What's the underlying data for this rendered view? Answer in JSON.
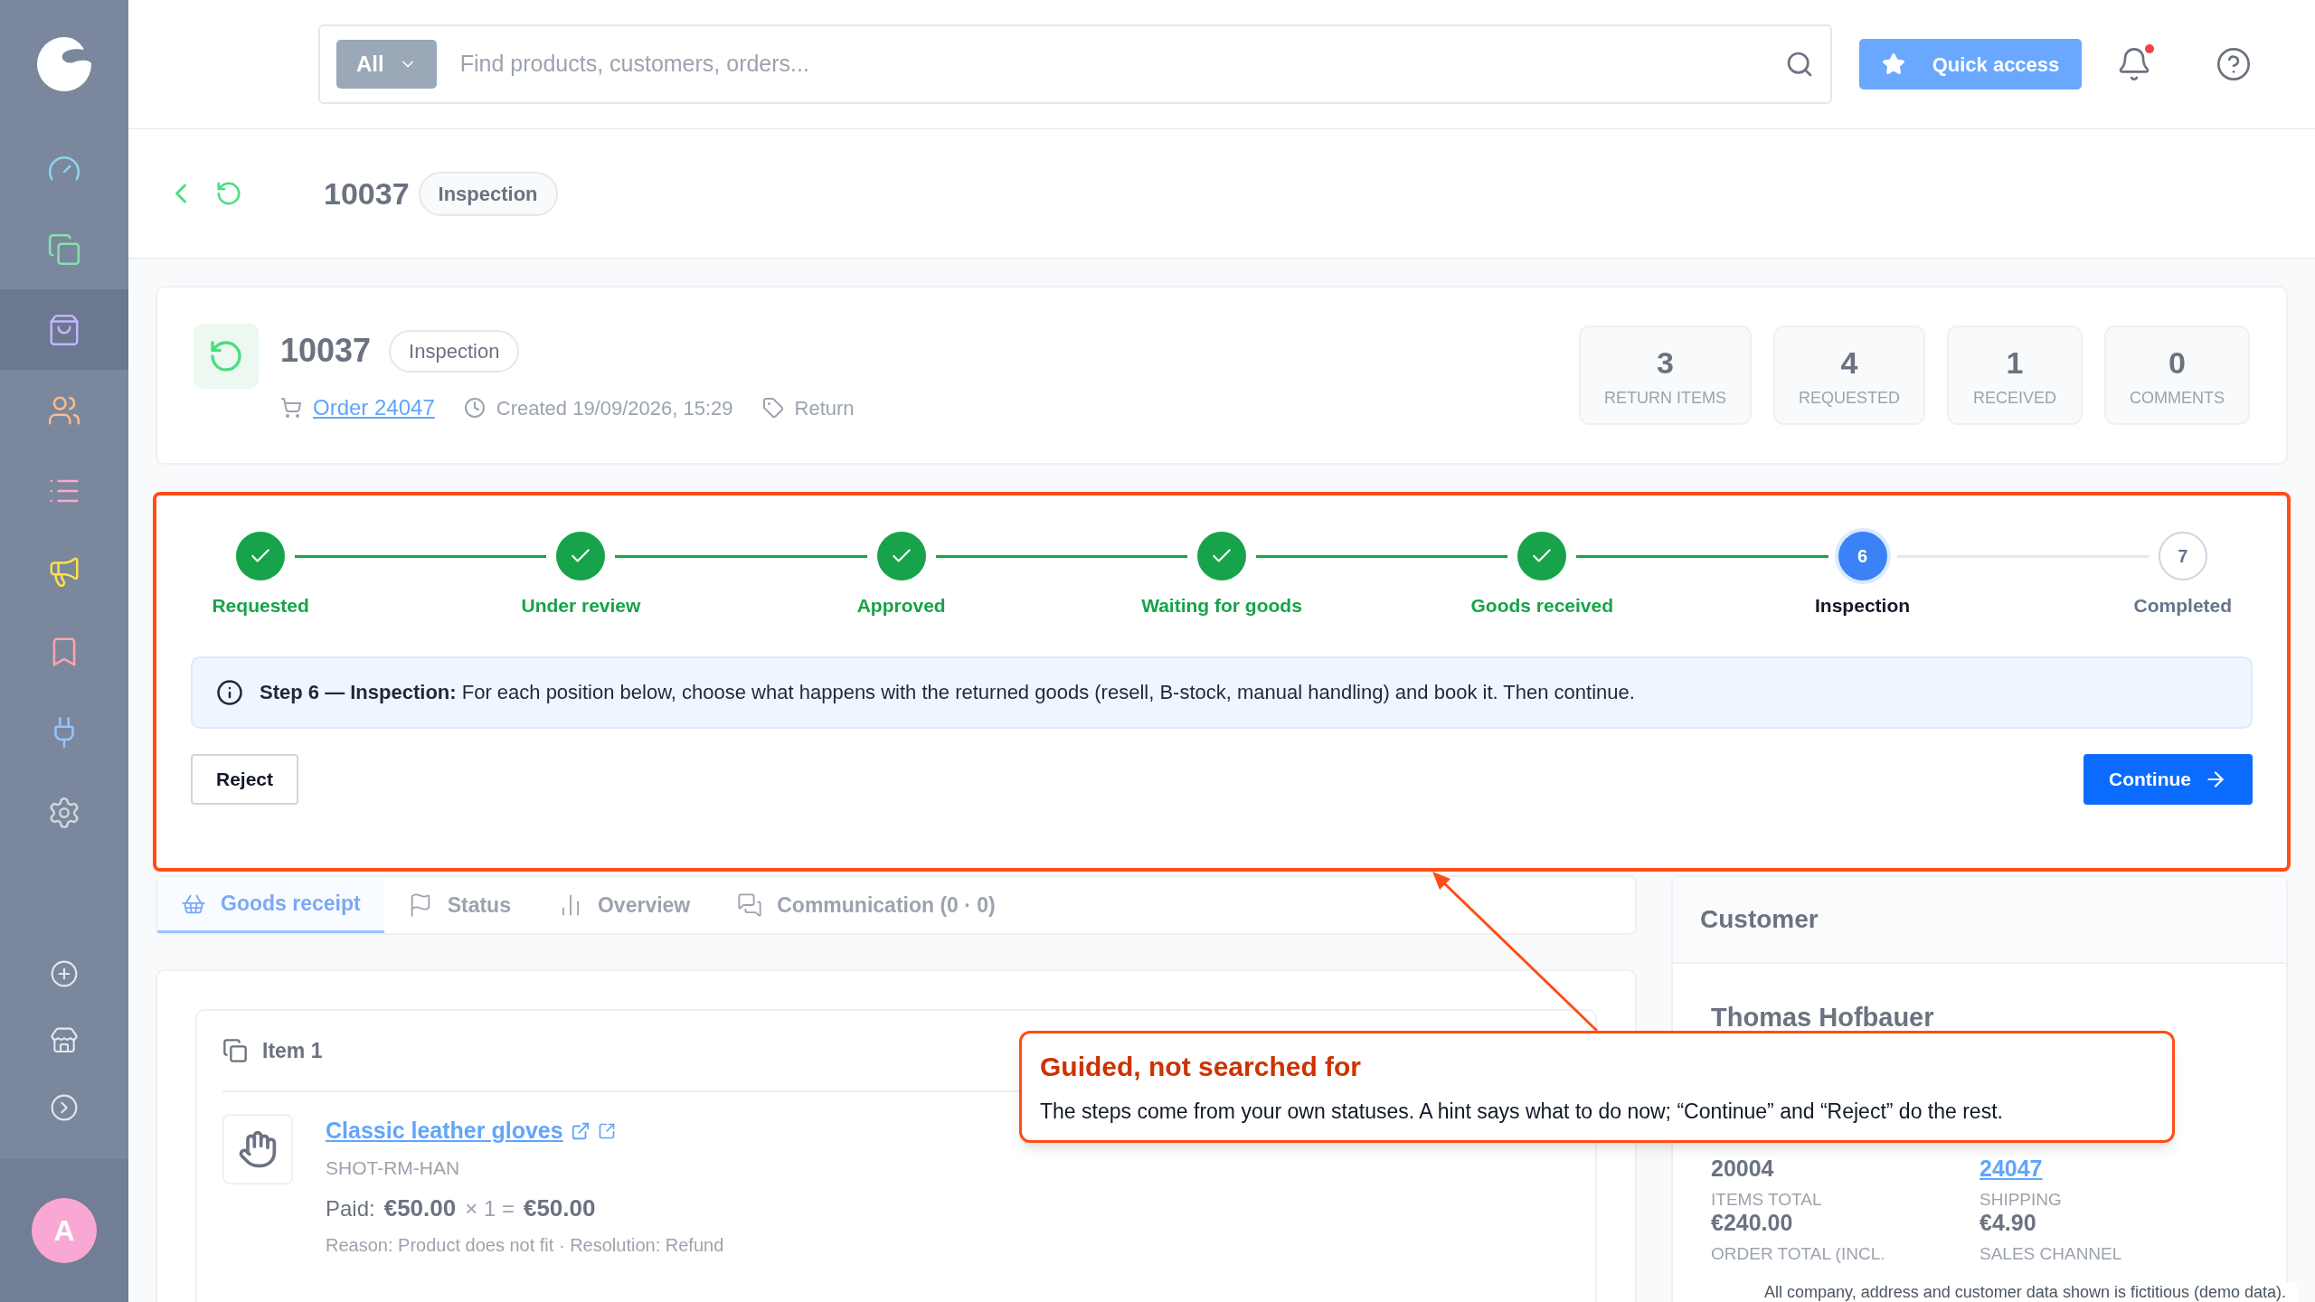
{
  "sidebar": {
    "items": [
      {
        "selected": false
      },
      {
        "selected": false
      },
      {
        "selected": true
      },
      {
        "selected": false
      },
      {
        "selected": false
      },
      {
        "selected": false
      },
      {
        "selected": false
      },
      {
        "selected": false
      },
      {
        "selected": false
      }
    ],
    "bottom_items": [
      {
        "selected": false
      },
      {
        "selected": false
      },
      {
        "selected": false
      }
    ],
    "avatar": "A"
  },
  "topbar": {
    "scope": "All",
    "search": {
      "placeholder": "Find products, customers, orders..."
    },
    "quick_access": "Quick access",
    "notification_dot": true
  },
  "header": {
    "title": "10037",
    "badge": "Inspection"
  },
  "summary": {
    "title": "10037",
    "badge": "Inspection",
    "order_link": "Order 24047",
    "created": "Created 19/09/2026, 15:29",
    "type": "Return",
    "stats": [
      {
        "value": "3",
        "label": "RETURN ITEMS"
      },
      {
        "value": "4",
        "label": "REQUESTED"
      },
      {
        "value": "1",
        "label": "RECEIVED"
      },
      {
        "value": "0",
        "label": "COMMENTS"
      }
    ]
  },
  "stepper": {
    "steps": [
      {
        "label": "Requested",
        "completed": true,
        "selected": false
      },
      {
        "label": "Under review",
        "completed": true,
        "selected": false
      },
      {
        "label": "Approved",
        "completed": true,
        "selected": false
      },
      {
        "label": "Waiting for goods",
        "completed": true,
        "selected": false
      },
      {
        "label": "Goods received",
        "completed": true,
        "selected": false
      },
      {
        "label": "Inspection",
        "number": "6",
        "completed": false,
        "selected": true
      },
      {
        "label": "Completed",
        "number": "7",
        "completed": false,
        "selected": false
      }
    ],
    "hint": "**Step 6 — Inspection:** For each position below, choose what happens with the returned goods (resell, B-stock, manual handling) and book it. Then continue.",
    "reject": "Reject",
    "continue": "Continue"
  },
  "tabs": [
    {
      "label": "Goods receipt",
      "selected": true
    },
    {
      "label": "Status",
      "selected": false
    },
    {
      "label": "Overview",
      "selected": false
    },
    {
      "label": "Communication (0 · 0)",
      "selected": false
    }
  ],
  "item": {
    "title": "Item 1",
    "product": "Classic leather gloves",
    "sku": "SHOT-RM-HAN",
    "paid_label": "Paid:",
    "price": "€50.00",
    "qty": "× 1 =",
    "total": "€50.00",
    "reason": "Reason: Product does not fit · Resolution: Refund"
  },
  "customer": {
    "title": "Customer",
    "name": "Thomas Hofbauer",
    "number": "20004",
    "order": "24047",
    "fields": [
      {
        "label": "ITEMS TOTAL",
        "value": "€240.00"
      },
      {
        "label": "SHIPPING",
        "value": "€4.90"
      }
    ],
    "more_labels": [
      "ORDER TOTAL (INCL.",
      "SALES CHANNEL"
    ]
  },
  "callout": {
    "title": "Guided, not searched for",
    "text": "The steps come from your own statuses. A hint says what to do now; “Continue” and “Reject” do the rest."
  },
  "disclaimer": "All company, address and customer data shown is fictitious (demo data)."
}
